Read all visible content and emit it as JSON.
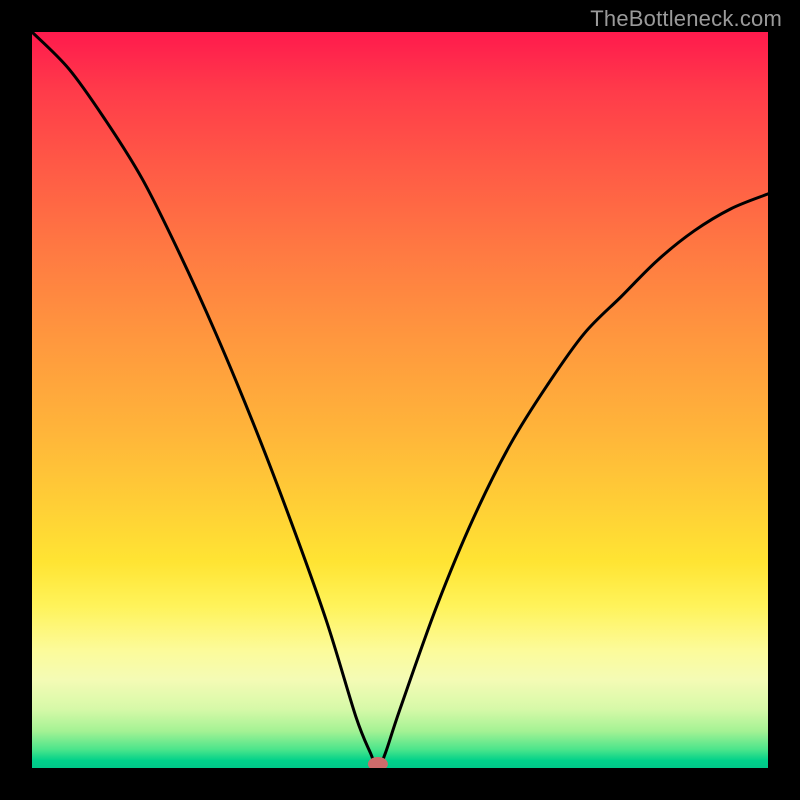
{
  "watermark": "TheBottleneck.com",
  "colors": {
    "frame": "#000000",
    "marker": "#cf6b6b",
    "curve": "#000000",
    "gradient_top": "#ff1a4d",
    "gradient_bottom": "#00c789"
  },
  "chart_data": {
    "type": "line",
    "title": "",
    "xlabel": "",
    "ylabel": "",
    "xlim": [
      0,
      100
    ],
    "ylim": [
      0,
      100
    ],
    "grid": false,
    "legend": false,
    "notes": "V-shaped bottleneck curve on rainbow heat gradient; minimum near x≈47, y≈0. Values are estimated from pixel positions (no axis tick labels present).",
    "series": [
      {
        "name": "bottleneck-curve",
        "x": [
          0,
          5,
          10,
          15,
          20,
          25,
          30,
          35,
          40,
          44,
          46,
          47,
          48,
          50,
          55,
          60,
          65,
          70,
          75,
          80,
          85,
          90,
          95,
          100
        ],
        "y": [
          100,
          95,
          88,
          80,
          70,
          59,
          47,
          34,
          20,
          7,
          2,
          0,
          2,
          8,
          22,
          34,
          44,
          52,
          59,
          64,
          69,
          73,
          76,
          78
        ]
      }
    ],
    "marker": {
      "x": 47,
      "y": 0
    }
  }
}
